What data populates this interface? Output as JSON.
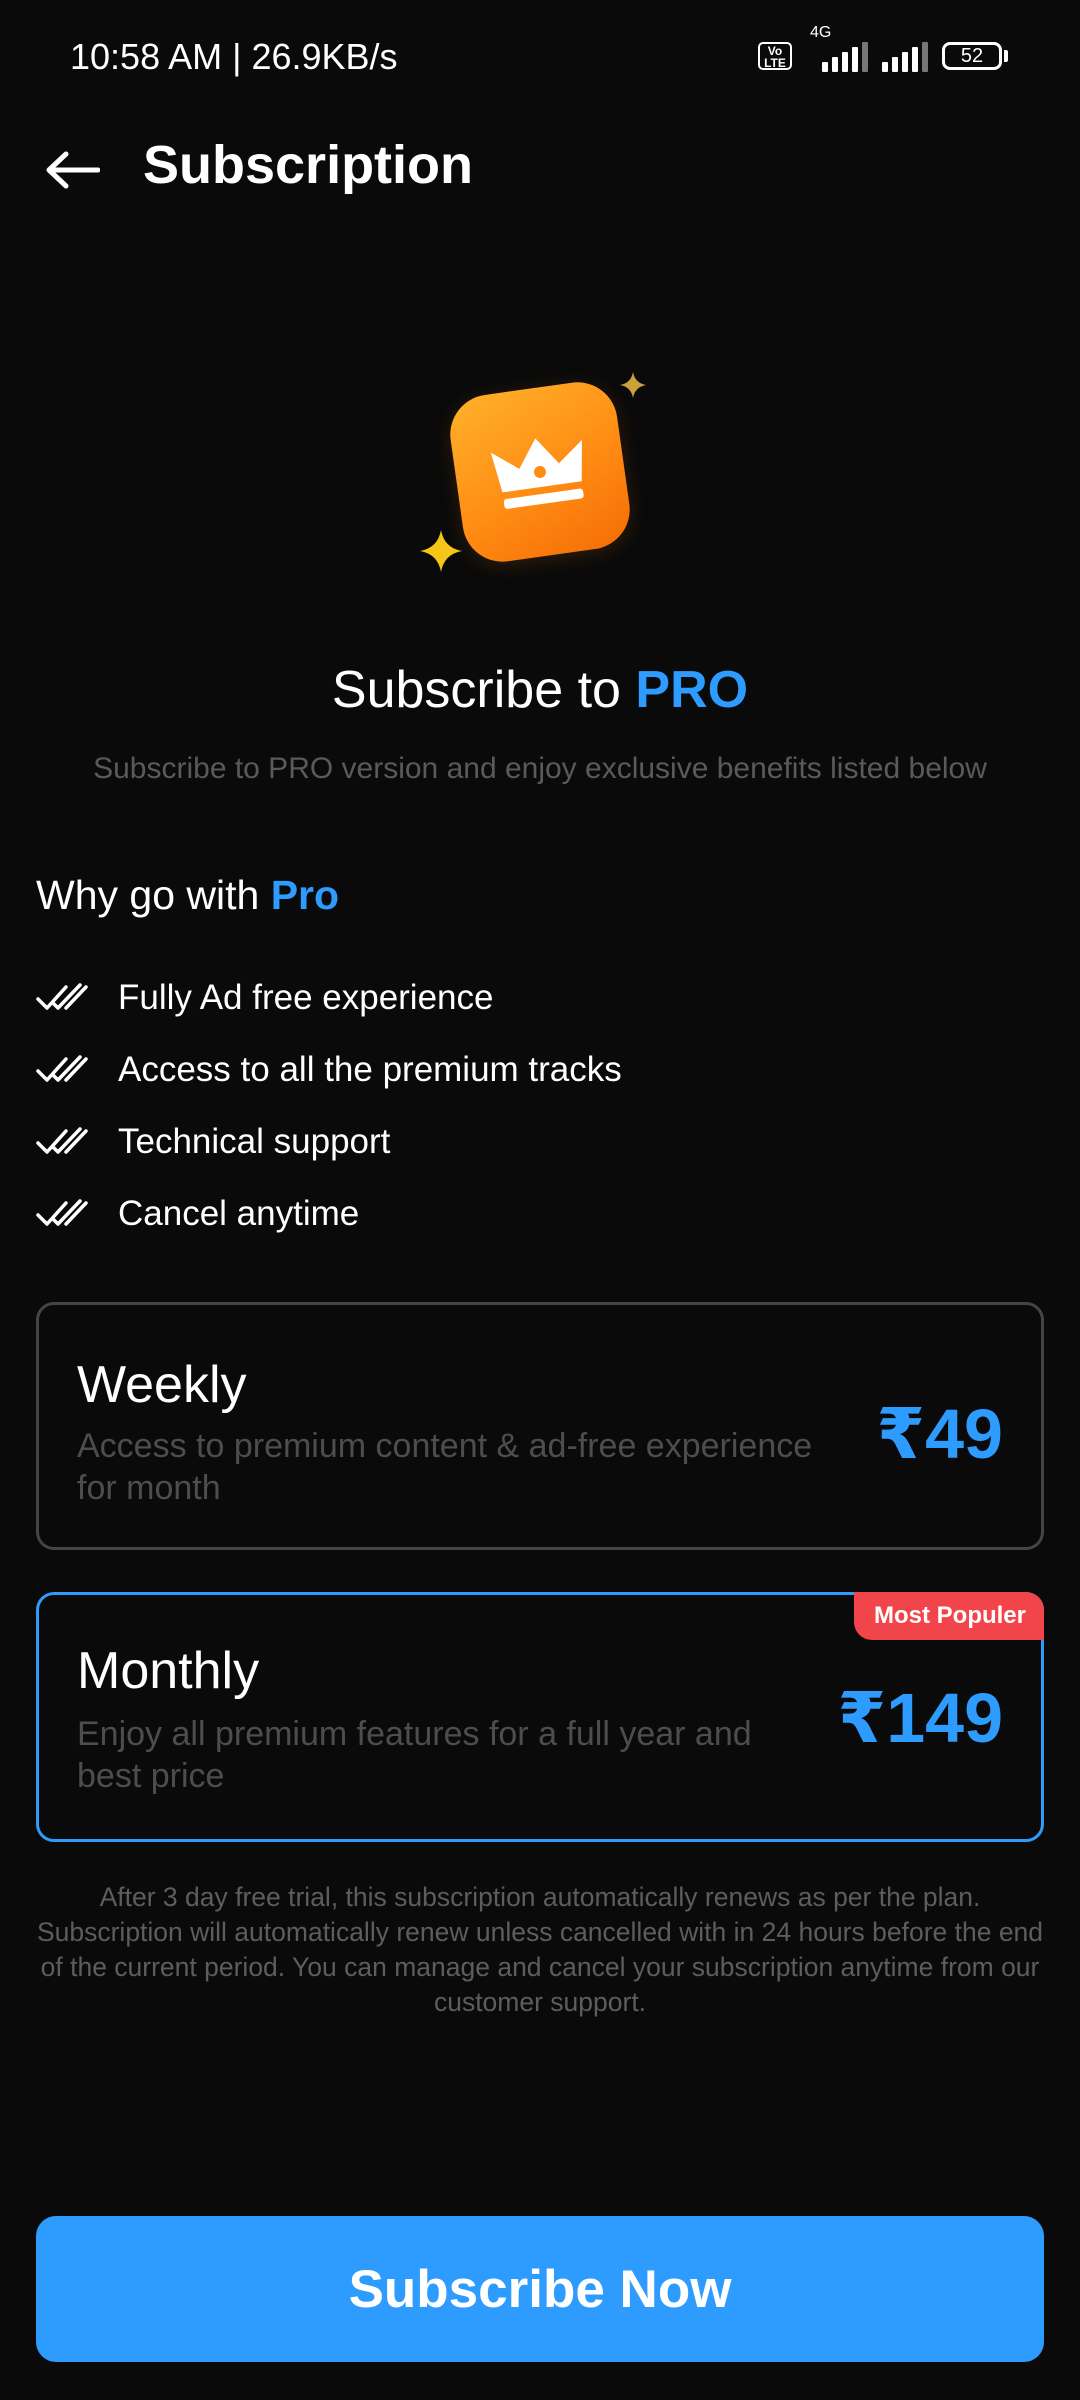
{
  "status_bar": {
    "time": "10:58 AM | 26.9KB/s",
    "volte": "Vo LTE",
    "network": "4G",
    "battery": "52"
  },
  "header": {
    "title": "Subscription",
    "back_icon": "arrow-left-icon"
  },
  "hero": {
    "title_prefix": "Subscribe to ",
    "title_accent": "PRO",
    "subtitle": "Subscribe to PRO version and enjoy exclusive benefits listed below"
  },
  "benefits": {
    "heading_prefix": "Why go with ",
    "heading_accent": "Pro",
    "items": [
      "Fully Ad free experience",
      "Access to all the premium tracks",
      "Technical support",
      "Cancel anytime"
    ]
  },
  "plans": [
    {
      "name": "Weekly",
      "description": "Access to premium content & ad-free experience for month",
      "price": "₹49"
    },
    {
      "name": "Monthly",
      "description": "Enjoy all premium features for a full year and best price",
      "price": "₹149",
      "badge": "Most Populer"
    }
  ],
  "disclaimer": "After 3 day free trial, this subscription automatically renews as per the plan. Subscription will automatically renew unless cancelled with in 24 hours before the end of the current period. You can manage and  cancel your subscription anytime from our customer support.",
  "cta": {
    "label": "Subscribe Now"
  },
  "colors": {
    "background": "#0a0a0a",
    "accent": "#2e9bff",
    "badge": "#f2454b",
    "crown_tile": "#ff8c14",
    "sparkle": "#f5c518"
  }
}
